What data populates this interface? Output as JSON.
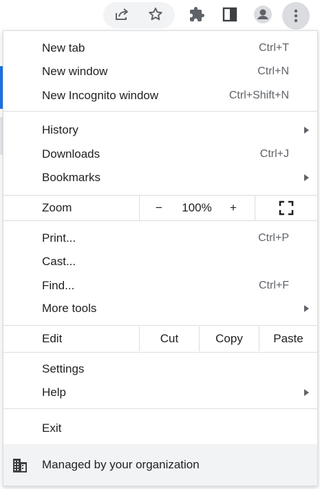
{
  "menu": {
    "new_tab": {
      "label": "New tab",
      "accel": "Ctrl+T"
    },
    "new_window": {
      "label": "New window",
      "accel": "Ctrl+N"
    },
    "new_incognito": {
      "label": "New Incognito window",
      "accel": "Ctrl+Shift+N"
    },
    "history": {
      "label": "History"
    },
    "downloads": {
      "label": "Downloads",
      "accel": "Ctrl+J"
    },
    "bookmarks": {
      "label": "Bookmarks"
    },
    "zoom": {
      "label": "Zoom",
      "minus": "−",
      "level": "100%",
      "plus": "+"
    },
    "print": {
      "label": "Print...",
      "accel": "Ctrl+P"
    },
    "cast": {
      "label": "Cast..."
    },
    "find": {
      "label": "Find...",
      "accel": "Ctrl+F"
    },
    "more_tools": {
      "label": "More tools"
    },
    "edit": {
      "label": "Edit",
      "cut": "Cut",
      "copy": "Copy",
      "paste": "Paste"
    },
    "settings": {
      "label": "Settings"
    },
    "help": {
      "label": "Help"
    },
    "exit": {
      "label": "Exit"
    },
    "managed": {
      "label": "Managed by your organization"
    }
  },
  "toolbar": {
    "icons": [
      "share-icon",
      "bookmark-star-icon",
      "extensions-icon",
      "side-panel-icon",
      "profile-icon",
      "more-menu-icon"
    ]
  },
  "colors": {
    "accent": "#1a73e8",
    "text": "#202124",
    "secondary_text": "#5f6368",
    "separator": "#dadce0",
    "footer_bg": "#f1f3f4"
  }
}
